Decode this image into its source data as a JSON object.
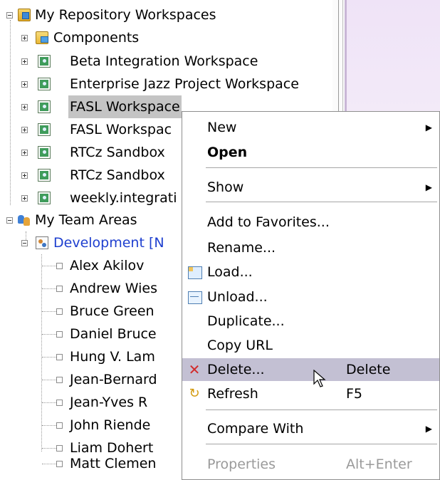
{
  "tree": {
    "repositories_label": "My Repository Workspaces",
    "components_label": "Components",
    "workspaces": [
      "Beta Integration Workspace",
      "Enterprise Jazz Project Workspace",
      "FASL Workspace",
      "FASL Workspac",
      "RTCz Sandbox",
      "RTCz Sandbox",
      "weekly.integrati"
    ],
    "team_areas_label": "My Team Areas",
    "development_label": "Development [N",
    "members": [
      "Alex Akilov",
      "Andrew Wies",
      "Bruce Green",
      "Daniel Bruce",
      "Hung V. Lam",
      "Jean-Bernard",
      "Jean-Yves R",
      "John Riende",
      "Liam Dohert",
      "Matt Clemen"
    ]
  },
  "context_menu": {
    "new": "New",
    "open": "Open",
    "show": "Show",
    "add_favorites": "Add to Favorites...",
    "rename": "Rename...",
    "load": "Load...",
    "unload": "Unload...",
    "duplicate": "Duplicate...",
    "copy_url": "Copy URL",
    "delete": "Delete...",
    "delete_accel": "Delete",
    "refresh": "Refresh",
    "refresh_accel": "F5",
    "compare_with": "Compare With",
    "properties": "Properties",
    "properties_accel": "Alt+Enter",
    "submenu_arrow": "▶"
  },
  "colors": {
    "highlight": "#c3c0d3",
    "selection": "#c4c4c4",
    "link_blue": "#1e3fcf",
    "delete_red": "#d22b2b"
  }
}
